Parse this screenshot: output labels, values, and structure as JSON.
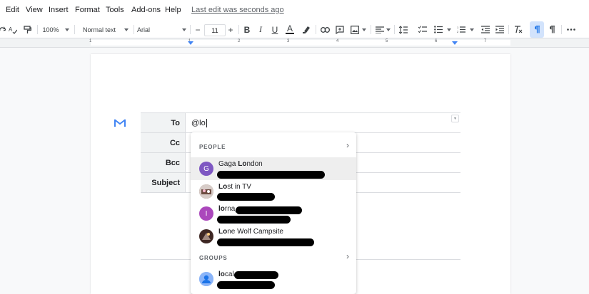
{
  "menu": {
    "items": [
      "Edit",
      "View",
      "Insert",
      "Format",
      "Tools",
      "Add-ons",
      "Help"
    ],
    "last_edit": "Last edit was seconds ago"
  },
  "toolbar": {
    "zoom": "100%",
    "style": "Normal text",
    "font": "Arial",
    "font_size": "11",
    "minus": "−",
    "plus": "+",
    "bold": "B",
    "italic": "I",
    "underline": "U",
    "text_color": "A",
    "text_color_bar": "#202124"
  },
  "ruler": {
    "numbers": [
      "1",
      "1",
      "2",
      "3",
      "4",
      "5",
      "6",
      "7"
    ]
  },
  "email_chip": {
    "rows": [
      {
        "label": "To",
        "value": "@lo"
      },
      {
        "label": "Cc",
        "value": ""
      },
      {
        "label": "Bcc",
        "value": ""
      },
      {
        "label": "Subject",
        "value": ""
      }
    ]
  },
  "autocomplete": {
    "people_header": "PEOPLE",
    "groups_header": "GROUPS",
    "chevron": "›",
    "people": [
      {
        "initial": "G",
        "name_bold": "Lo",
        "name_pre": "Gaga ",
        "name_post": "ndon",
        "avatar_color": "#7e57c2"
      },
      {
        "initial": "",
        "name_pre": "",
        "name_bold": "Lo",
        "name_post": "st in TV",
        "avatar_color": "#8d6e63"
      },
      {
        "initial": "I",
        "name_pre": "",
        "name_bold": "lo",
        "name_post": "rna_",
        "avatar_color": "#ab47bc"
      },
      {
        "initial": "",
        "name_pre": "",
        "name_bold": "Lo",
        "name_post": "ne Wolf Campsite",
        "avatar_color": "#5d4037"
      }
    ],
    "groups": [
      {
        "initial": "",
        "name_pre": "",
        "name_bold": "lo",
        "name_post": "cal",
        "avatar_color": "#8ab4f8"
      }
    ]
  },
  "colors": {
    "accent": "#4285f4",
    "gmail_red": "#4285f4"
  }
}
